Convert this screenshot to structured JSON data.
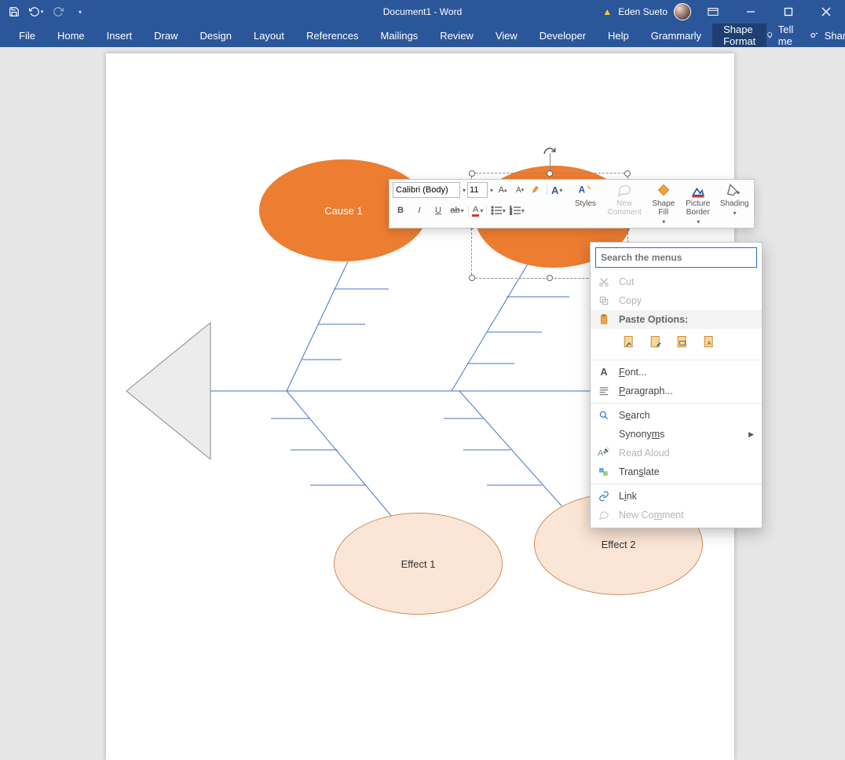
{
  "app": {
    "title": "Document1  -  Word"
  },
  "user": {
    "name": "Eden Sueto"
  },
  "ribbon": {
    "tabs": [
      "File",
      "Home",
      "Insert",
      "Draw",
      "Design",
      "Layout",
      "References",
      "Mailings",
      "Review",
      "View",
      "Developer",
      "Help",
      "Grammarly",
      "Shape Format"
    ],
    "active": "Shape Format",
    "tell_me": "Tell me",
    "share": "Share"
  },
  "canvas": {
    "cause1": "Cause 1",
    "effect1": "Effect 1",
    "effect2": "Effect 2"
  },
  "minitoolbar": {
    "font": "Calibri (Body)",
    "size": "11",
    "styles": "Styles",
    "new_comment": "New\nComment",
    "shape_fill": "Shape\nFill",
    "picture_border": "Picture\nBorder",
    "shading": "Shading"
  },
  "context": {
    "search_placeholder": "Search the menus",
    "cut": "Cut",
    "copy": "Copy",
    "paste_options": "Paste Options:",
    "font": "Font...",
    "paragraph": "Paragraph...",
    "search": "Search",
    "synonyms": "Synonyms",
    "read_aloud": "Read Aloud",
    "translate": "Translate",
    "link": "Link",
    "new_comment": "New Comment"
  }
}
